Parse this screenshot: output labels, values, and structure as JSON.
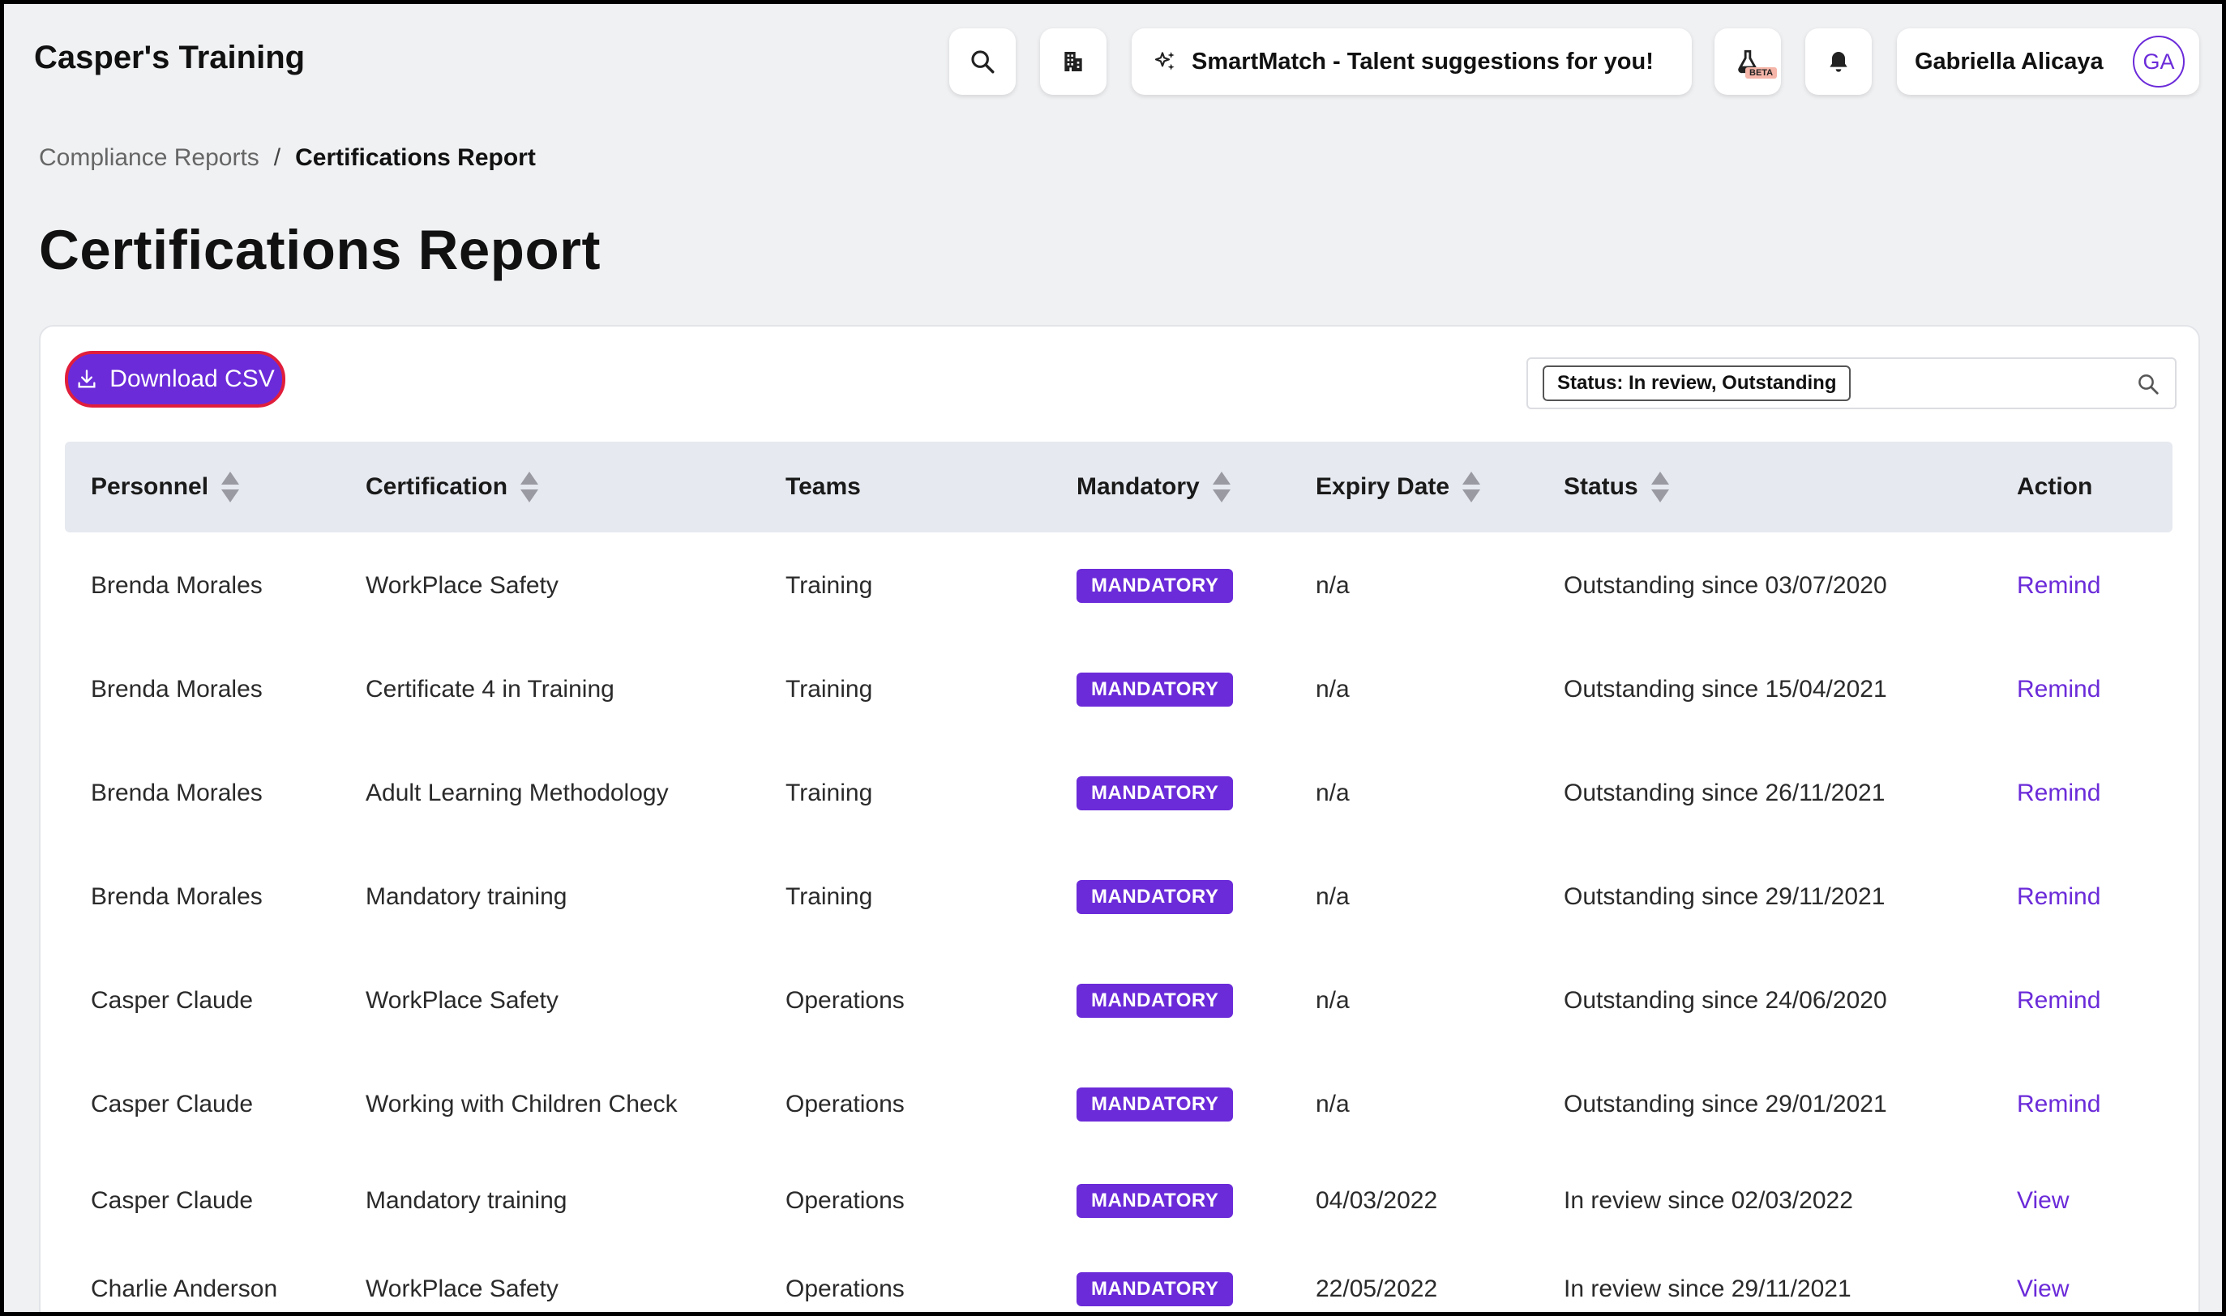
{
  "app": {
    "title": "Casper's Training"
  },
  "header": {
    "smartmatch_label": "SmartMatch - Talent suggestions for you!",
    "beta_label": "BETA",
    "user_name": "Gabriella Alicaya",
    "user_initials": "GA"
  },
  "breadcrumb": {
    "parent": "Compliance Reports",
    "separator": "/",
    "current": "Certifications Report"
  },
  "page": {
    "title": "Certifications Report"
  },
  "toolbar": {
    "download_label": "Download CSV",
    "filter_chip": "Status: In review, Outstanding"
  },
  "table": {
    "columns": [
      "Personnel",
      "Certification",
      "Teams",
      "Mandatory",
      "Expiry Date",
      "Status",
      "Action"
    ],
    "rows": [
      {
        "personnel": "Brenda Morales",
        "certification": "WorkPlace Safety",
        "team": "Training",
        "mandatory": "MANDATORY",
        "expiry": "n/a",
        "status": "Outstanding since 03/07/2020",
        "action": "Remind"
      },
      {
        "personnel": "Brenda Morales",
        "certification": "Certificate 4 in Training",
        "team": "Training",
        "mandatory": "MANDATORY",
        "expiry": "n/a",
        "status": "Outstanding since 15/04/2021",
        "action": "Remind"
      },
      {
        "personnel": "Brenda Morales",
        "certification": "Adult Learning Methodology",
        "team": "Training",
        "mandatory": "MANDATORY",
        "expiry": "n/a",
        "status": "Outstanding since 26/11/2021",
        "action": "Remind"
      },
      {
        "personnel": "Brenda Morales",
        "certification": "Mandatory training",
        "team": "Training",
        "mandatory": "MANDATORY",
        "expiry": "n/a",
        "status": "Outstanding since 29/11/2021",
        "action": "Remind"
      },
      {
        "personnel": "Casper Claude",
        "certification": "WorkPlace Safety",
        "team": "Operations",
        "mandatory": "MANDATORY",
        "expiry": "n/a",
        "status": "Outstanding since 24/06/2020",
        "action": "Remind"
      },
      {
        "personnel": "Casper Claude",
        "certification": "Working with Children Check",
        "team": "Operations",
        "mandatory": "MANDATORY",
        "expiry": "n/a",
        "status": "Outstanding since 29/01/2021",
        "action": "Remind"
      },
      {
        "personnel": "Casper Claude",
        "certification": "Mandatory training",
        "team": "Operations",
        "mandatory": "MANDATORY",
        "expiry": "04/03/2022",
        "status": "In review since 02/03/2022",
        "action": "View"
      },
      {
        "personnel": "Charlie Anderson",
        "certification": "WorkPlace Safety",
        "team": "Operations",
        "mandatory": "MANDATORY",
        "expiry": "22/05/2022",
        "status": "In review since 29/11/2021",
        "action": "View"
      }
    ]
  },
  "colors": {
    "accent": "#6b2bd9",
    "focus_ring": "#e01e3c",
    "header_bg": "#e6e9ef"
  }
}
